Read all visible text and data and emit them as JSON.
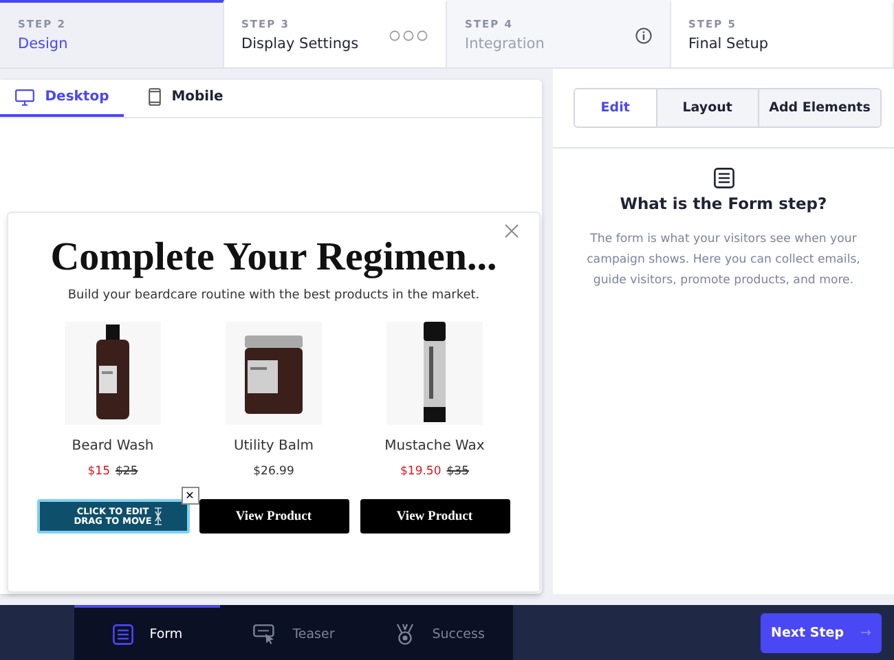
{
  "steps": [
    {
      "step": "STEP 2",
      "title": "Design",
      "selected": true,
      "disabled": false,
      "kind": "plain"
    },
    {
      "step": "STEP 3",
      "title": "Display Settings",
      "selected": false,
      "disabled": false,
      "kind": "dots"
    },
    {
      "step": "STEP 4",
      "title": "Integration",
      "selected": false,
      "disabled": true,
      "kind": "info"
    },
    {
      "step": "STEP 5",
      "title": "Final Setup",
      "selected": false,
      "disabled": false,
      "kind": "plain"
    }
  ],
  "device_tabs": [
    {
      "label": "Desktop",
      "kind": "desktop",
      "selected": true
    },
    {
      "label": "Mobile",
      "kind": "mobile",
      "selected": false
    }
  ],
  "popup": {
    "heading": "Complete Your Regimen...",
    "subheading": "Build your beardcare routine with the best products in the market.",
    "products": [
      {
        "name": "Beard Wash",
        "kind": "bottle",
        "price": "$15",
        "compare_price": "$25",
        "button": {
          "kind": "editing",
          "overlay": [
            "CLICK TO EDIT",
            "DRAG TO MOVE"
          ],
          "close": "✕"
        }
      },
      {
        "name": "Utility Balm",
        "kind": "jar",
        "price": "$26.99",
        "button": {
          "kind": "normal",
          "label": "View Product"
        }
      },
      {
        "name": "Mustache Wax",
        "kind": "stick",
        "price": "$19.50",
        "compare_price": "$35",
        "button": {
          "kind": "normal",
          "label": "View Product"
        }
      }
    ]
  },
  "panel_tabs": [
    {
      "label": "Edit",
      "selected": true
    },
    {
      "label": "Layout",
      "selected": false
    },
    {
      "label": "Add Elements",
      "selected": false
    }
  ],
  "help": {
    "title": "What is the Form step?",
    "text": "The form is what your visitors see when your campaign shows. Here you can collect emails, guide visitors, promote products, and more."
  },
  "bottom_tabs": [
    {
      "label": "Form",
      "kind": "form",
      "selected": true
    },
    {
      "label": "Teaser",
      "kind": "teaser",
      "selected": false
    },
    {
      "label": "Success",
      "kind": "success",
      "selected": false
    }
  ],
  "next_button": {
    "label": "Next Step",
    "arrow": "→"
  }
}
